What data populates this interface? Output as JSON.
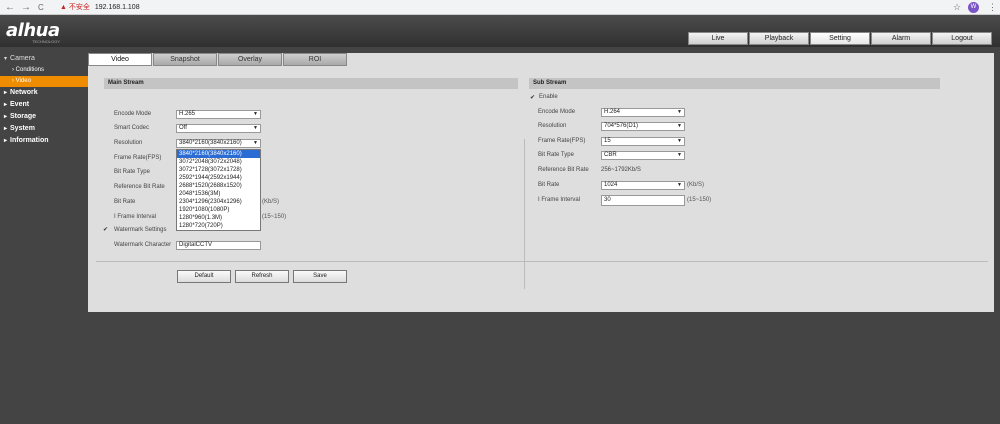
{
  "browser": {
    "back": "←",
    "forward": "→",
    "reload": "C",
    "security_warning": "▲ 不安全",
    "url": "192.168.1.108",
    "star": "☆",
    "avatar_letter": "W",
    "menu": "⋮"
  },
  "header": {
    "logo": "alhua",
    "logo_sub": "TECHNOLOGY",
    "nav": [
      {
        "label": "Live"
      },
      {
        "label": "Playback"
      },
      {
        "label": "Setting"
      },
      {
        "label": "Alarm"
      },
      {
        "label": "Logout"
      }
    ]
  },
  "sidebar": {
    "camera": "Camera",
    "conditions": "Conditions",
    "video": "Video",
    "network": "Network",
    "event": "Event",
    "storage": "Storage",
    "system": "System",
    "information": "Information"
  },
  "tabs": [
    {
      "label": "Video"
    },
    {
      "label": "Snapshot"
    },
    {
      "label": "Overlay"
    },
    {
      "label": "ROI"
    }
  ],
  "main_stream": {
    "title": "Main Stream",
    "encode_mode_label": "Encode Mode",
    "encode_mode_value": "H.265",
    "smart_codec_label": "Smart Codec",
    "smart_codec_value": "Off",
    "resolution_label": "Resolution",
    "resolution_value": "3840*2160(3840x2160)",
    "frame_rate_label": "Frame Rate(FPS)",
    "bit_rate_type_label": "Bit Rate Type",
    "reference_bit_rate_label": "Reference Bit Rate",
    "bit_rate_label": "Bit Rate",
    "bit_rate_unit": "(Kb/S)",
    "iframe_label": "I Frame Interval",
    "iframe_hint": "(15~150)",
    "watermark_settings_label": "Watermark Settings",
    "watermark_character_label": "Watermark Character",
    "watermark_character_value": "DigitalCCTV",
    "resolution_options": [
      "3840*2160(3840x2160)",
      "3072*2048(3072x2048)",
      "3072*1728(3072x1728)",
      "2592*1944(2592x1944)",
      "2688*1520(2688x1520)",
      "2048*1536(3M)",
      "2304*1296(2304x1296)",
      "1920*1080(1080P)",
      "1280*960(1.3M)",
      "1280*720(720P)"
    ]
  },
  "sub_stream": {
    "title": "Sub Stream",
    "enable_label": "Enable",
    "encode_mode_label": "Encode Mode",
    "encode_mode_value": "H.264",
    "resolution_label": "Resolution",
    "resolution_value": "704*576(D1)",
    "frame_rate_label": "Frame Rate(FPS)",
    "frame_rate_value": "15",
    "bit_rate_type_label": "Bit Rate Type",
    "bit_rate_type_value": "CBR",
    "reference_bit_rate_label": "Reference Bit Rate",
    "reference_bit_rate_value": "256~1792Kb/S",
    "bit_rate_label": "Bit Rate",
    "bit_rate_value": "1024",
    "bit_rate_unit": "(Kb/S)",
    "iframe_label": "I Frame Interval",
    "iframe_value": "30",
    "iframe_hint": "(15~150)"
  },
  "buttons": {
    "default": "Default",
    "refresh": "Refresh",
    "save": "Save"
  },
  "colors": {
    "active_sidebar": "#f08c00",
    "dropdown_highlight": "#2a6bd4"
  }
}
